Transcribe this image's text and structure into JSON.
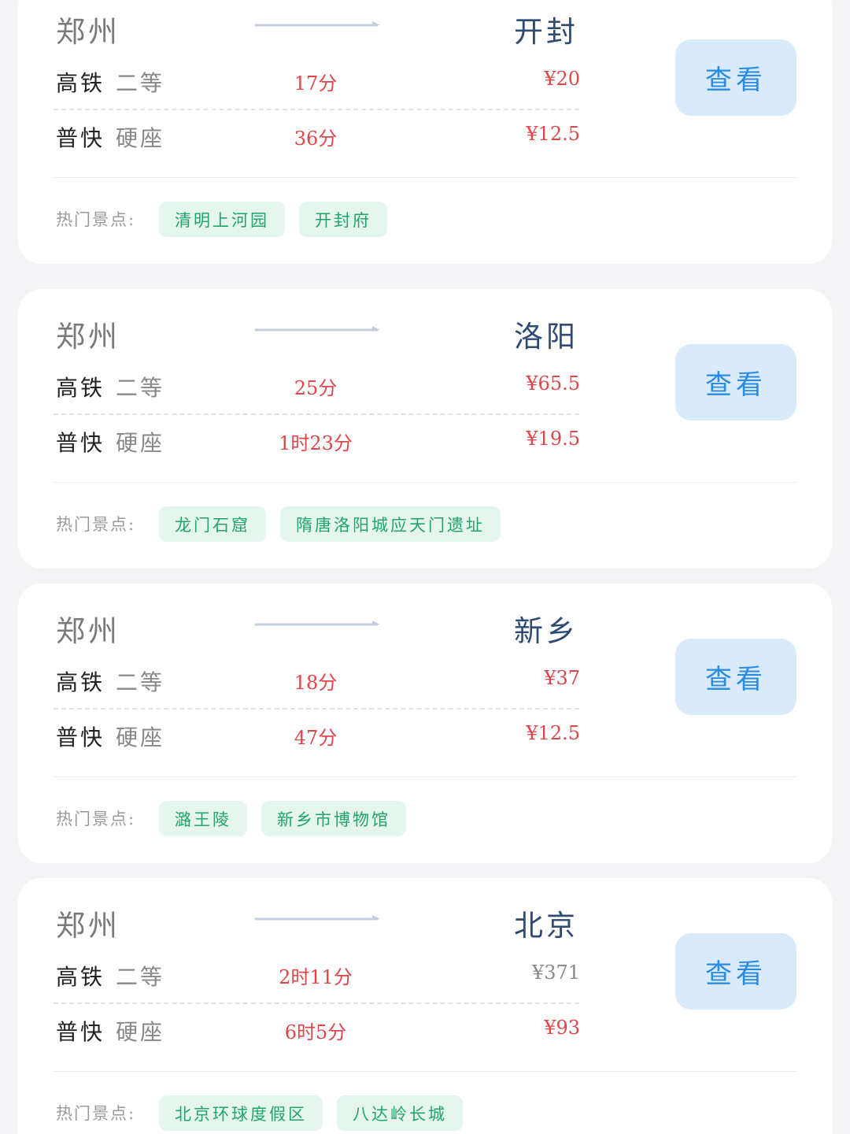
{
  "routes": [
    {
      "from": "郑州",
      "to": "开封",
      "rows": [
        {
          "train": "高铁",
          "seat": "二等",
          "duration": "17分",
          "price": "¥20",
          "price_muted": false
        },
        {
          "train": "普快",
          "seat": "硬座",
          "duration": "36分",
          "price": "¥12.5",
          "price_muted": false
        }
      ],
      "button_label": "查看",
      "spots_label": "热门景点:",
      "spots": [
        "清明上河园",
        "开封府"
      ]
    },
    {
      "from": "郑州",
      "to": "洛阳",
      "rows": [
        {
          "train": "高铁",
          "seat": "二等",
          "duration": "25分",
          "price": "¥65.5",
          "price_muted": false
        },
        {
          "train": "普快",
          "seat": "硬座",
          "duration": "1时23分",
          "price": "¥19.5",
          "price_muted": false
        }
      ],
      "button_label": "查看",
      "spots_label": "热门景点:",
      "spots": [
        "龙门石窟",
        "隋唐洛阳城应天门遗址"
      ]
    },
    {
      "from": "郑州",
      "to": "新乡",
      "rows": [
        {
          "train": "高铁",
          "seat": "二等",
          "duration": "18分",
          "price": "¥37",
          "price_muted": false
        },
        {
          "train": "普快",
          "seat": "硬座",
          "duration": "47分",
          "price": "¥12.5",
          "price_muted": false
        }
      ],
      "button_label": "查看",
      "spots_label": "热门景点:",
      "spots": [
        "潞王陵",
        "新乡市博物馆"
      ]
    },
    {
      "from": "郑州",
      "to": "北京",
      "rows": [
        {
          "train": "高铁",
          "seat": "二等",
          "duration": "2时11分",
          "price": "¥371",
          "price_muted": true
        },
        {
          "train": "普快",
          "seat": "硬座",
          "duration": "6时5分",
          "price": "¥93",
          "price_muted": false
        }
      ],
      "button_label": "查看",
      "spots_label": "热门景点:",
      "spots": [
        "北京环球度假区",
        "八达岭长城"
      ]
    }
  ],
  "colors": {
    "price": "#e0454a",
    "button_bg": "#d9eafb",
    "button_text": "#2b8be0",
    "tag_bg": "#e5f6ee",
    "tag_text": "#22a46b",
    "destination": "#2f4a73"
  },
  "icons": {
    "route_arrow": "arrow-right-icon"
  }
}
